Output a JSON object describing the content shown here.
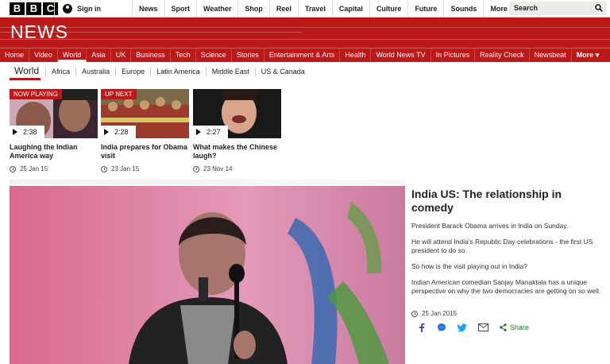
{
  "brand": {
    "logo_letters": [
      "B",
      "B",
      "C"
    ],
    "masthead": "NEWS"
  },
  "account": {
    "signin_label": "Sign in"
  },
  "topnav": {
    "items": [
      "News",
      "Sport",
      "Weather",
      "Shop",
      "Reel",
      "Travel",
      "Capital",
      "Culture",
      "Future",
      "Sounds"
    ],
    "more_label": "More",
    "more_caret": "▾"
  },
  "search": {
    "placeholder": "Search"
  },
  "mainnav": {
    "items": [
      "Home",
      "Video",
      "World",
      "Asia",
      "UK",
      "Business",
      "Tech",
      "Science",
      "Stories",
      "Entertainment & Arts",
      "Health",
      "World News TV",
      "In Pictures",
      "Reality Check",
      "Newsbeat"
    ],
    "active": "World",
    "more_label": "More ▾"
  },
  "subnav": {
    "current": "World",
    "items": [
      "Africa",
      "Australia",
      "Europe",
      "Latin America",
      "Middle East",
      "US & Canada"
    ]
  },
  "videos": [
    {
      "badge": "NOW PLAYING",
      "duration": "2:38",
      "title": "Laughing the Indian America way",
      "date": "25 Jan 15"
    },
    {
      "badge": "UP NEXT",
      "duration": "2:28",
      "title": "India prepares for Obama visit",
      "date": "23 Jan 15"
    },
    {
      "badge": "",
      "duration": "2:27",
      "title": "What makes the Chinese laugh?",
      "date": "23 Nov 14"
    }
  ],
  "article": {
    "title": "India US: The relationship in comedy",
    "paragraphs": [
      "President Barack Obama arrives in India on Sunday.",
      "He will attend India's Republic Day celebrations - the first US president to do so.",
      "So how is the visit playing out in India?",
      "Indian American comedian Sanjay Manaktala has a unique perspective on why the two democracies are getting on so well."
    ],
    "date": "25 Jan 2015",
    "share_label": "Share"
  },
  "colors": {
    "brand_red": "#bb1919",
    "share_green": "#1c7b2c"
  }
}
